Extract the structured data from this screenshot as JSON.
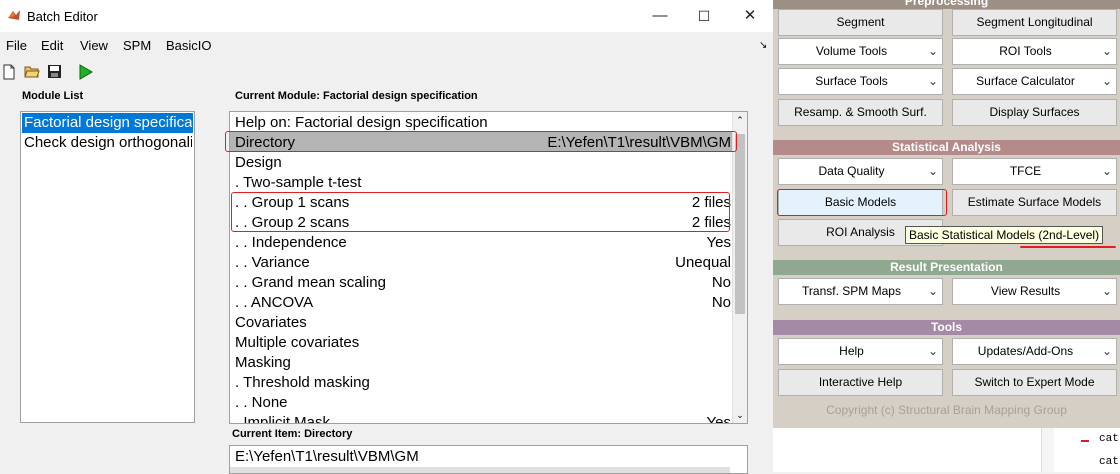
{
  "window": {
    "title": "Batch Editor",
    "controls": {
      "minimize": "—",
      "maximize": "☐",
      "close": "✕"
    }
  },
  "menu": [
    "File",
    "Edit",
    "View",
    "SPM",
    "BasicIO"
  ],
  "menu_arrow": "↘",
  "panels": {
    "module_list_label": "Module List",
    "current_module_label": "Current Module: Factorial design specification",
    "current_item_label": "Current Item: Directory"
  },
  "modules": [
    "Factorial design specificatio",
    "Check design orthogonality"
  ],
  "module_rows": [
    {
      "label": "Help on: Factorial design specification",
      "value": ""
    },
    {
      "label": "Directory",
      "value": "E:\\Yefen\\T1\\result\\VBM\\GM"
    },
    {
      "label": "Design",
      "value": ""
    },
    {
      "label": ". Two-sample t-test",
      "value": ""
    },
    {
      "label": ". . Group 1 scans",
      "value": "2 files"
    },
    {
      "label": ". . Group 2 scans",
      "value": "2 files"
    },
    {
      "label": ". . Independence",
      "value": "Yes"
    },
    {
      "label": ". . Variance",
      "value": "Unequal"
    },
    {
      "label": ". . Grand mean scaling",
      "value": "No"
    },
    {
      "label": ". . ANCOVA",
      "value": "No"
    },
    {
      "label": "Covariates",
      "value": ""
    },
    {
      "label": "Multiple covariates",
      "value": ""
    },
    {
      "label": "Masking",
      "value": ""
    },
    {
      "label": ". Threshold masking",
      "value": ""
    },
    {
      "label": ". . None",
      "value": ""
    },
    {
      "label": ". Implicit Mask",
      "value": "Yes"
    }
  ],
  "current_item_value": "E:\\Yefen\\T1\\result\\VBM\\GM",
  "spm_panel": {
    "top_section": "Preprocessing",
    "row1": {
      "left": "Segment",
      "right": "Segment Longitudinal"
    },
    "row2": {
      "left": "Volume Tools",
      "right": "ROI Tools"
    },
    "row3": {
      "left": "Surface Tools",
      "right": "Surface Calculator"
    },
    "row4": {
      "left": "Resamp. & Smooth Surf.",
      "right": "Display Surfaces"
    },
    "stat_section": "Statistical Analysis",
    "row5": {
      "left": "Data Quality",
      "right": "TFCE"
    },
    "row6": {
      "left": "Basic Models",
      "right": "Estimate Surface Models"
    },
    "row7": {
      "left": "ROI Analysis"
    },
    "tooltip": "Basic Statistical Models (2nd-Level)",
    "result_section": "Result Presentation",
    "row8": {
      "left": "Transf. SPM Maps",
      "right": "View Results"
    },
    "tools_section": "Tools",
    "row9": {
      "left": "Help",
      "right": "Updates/Add-Ons"
    },
    "row10": {
      "left": "Interactive Help",
      "right": "Switch to Expert Mode"
    },
    "copyright": "Copyright (c) Structural Brain Mapping Group",
    "chevron": "⌄"
  },
  "editor_snippet": [
    "cat",
    "cat"
  ],
  "colors": {
    "selection": "#0078d7",
    "directory_row": "#b4b4b4",
    "highlight_box": "#e02020",
    "section_header": "#9c8f84",
    "stat_header": "#b58a8a",
    "result_header": "#8fa88f",
    "tools_header": "#a58aa5"
  }
}
